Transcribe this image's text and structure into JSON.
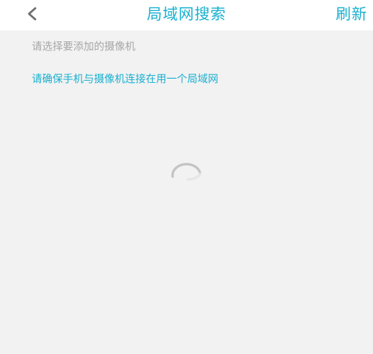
{
  "header": {
    "title": "局域网搜索",
    "refresh_label": "刷新",
    "back_icon": "chevron-left-icon"
  },
  "content": {
    "select_hint": "请选择要添加的摄像机",
    "lan_hint": "请确保手机与摄像机连接在用一个局域网"
  },
  "loading": {
    "icon": "loading-spinner-icon"
  },
  "colors": {
    "accent": "#1ab0d0",
    "hint_gray": "#a6a6a6",
    "background": "#f2f2f2",
    "header_bg": "#ffffff"
  }
}
